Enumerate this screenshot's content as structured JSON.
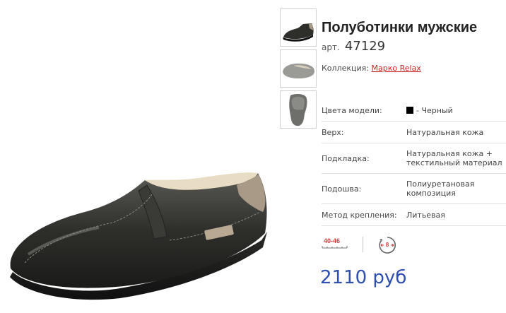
{
  "product": {
    "title": "Полуботинки мужские",
    "article_label": "арт.",
    "article_number": "47129",
    "collection_label": "Коллекция:",
    "collection_link": "Марко Relax",
    "price": "2110 руб"
  },
  "thumbnails": [
    {
      "name": "side-view"
    },
    {
      "name": "top-view"
    },
    {
      "name": "sole-view"
    }
  ],
  "properties": [
    {
      "label": "Цвета модели:",
      "value": "- Черный",
      "swatch_color": "#000000"
    },
    {
      "label": "Верх:",
      "value": "Натуральная кожа"
    },
    {
      "label": "Подкладка:",
      "value": "Натуральная кожа + текстильный материал"
    },
    {
      "label": "Подошва:",
      "value": "Полиуретановая композиция"
    },
    {
      "label": "Метод крепления:",
      "value": "Литьевая"
    }
  ],
  "badges": {
    "size_range": "40-46",
    "width": "8",
    "size_icon": "ruler-icon",
    "width_icon": "width-arrows-icon"
  },
  "colors": {
    "price": "#2c4fb0",
    "link": "#cc2222",
    "badge": "#d23c3c"
  }
}
